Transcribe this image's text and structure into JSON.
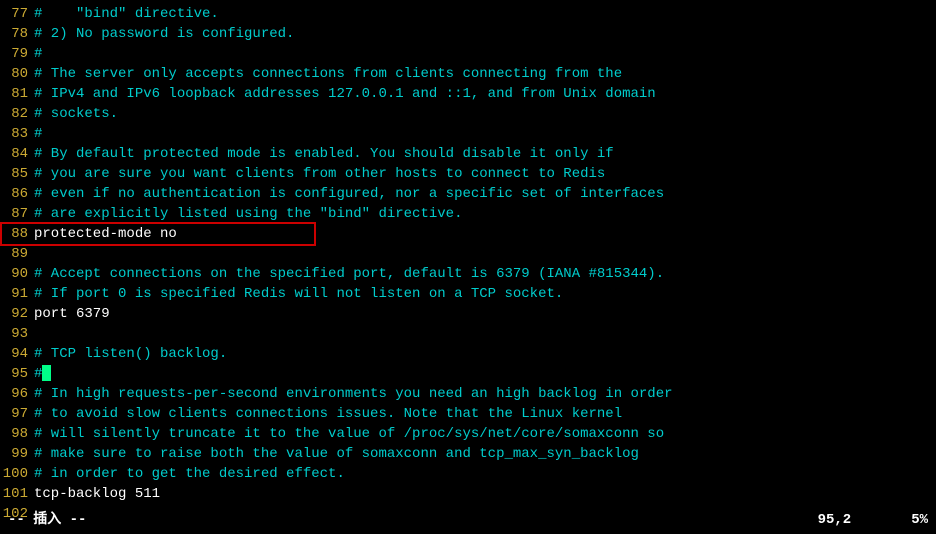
{
  "lines": [
    {
      "no": "77",
      "text": "#    \"bind\" directive.",
      "style": "comment"
    },
    {
      "no": "78",
      "text": "# 2) No password is configured.",
      "style": "comment"
    },
    {
      "no": "79",
      "text": "#",
      "style": "comment"
    },
    {
      "no": "80",
      "text": "# The server only accepts connections from clients connecting from the",
      "style": "comment"
    },
    {
      "no": "81",
      "text": "# IPv4 and IPv6 loopback addresses 127.0.0.1 and ::1, and from Unix domain",
      "style": "comment"
    },
    {
      "no": "82",
      "text": "# sockets.",
      "style": "comment"
    },
    {
      "no": "83",
      "text": "#",
      "style": "comment"
    },
    {
      "no": "84",
      "text": "# By default protected mode is enabled. You should disable it only if",
      "style": "comment"
    },
    {
      "no": "85",
      "text": "# you are sure you want clients from other hosts to connect to Redis",
      "style": "comment"
    },
    {
      "no": "86",
      "text": "# even if no authentication is configured, nor a specific set of interfaces",
      "style": "comment"
    },
    {
      "no": "87",
      "text": "# are explicitly listed using the \"bind\" directive.",
      "style": "comment"
    },
    {
      "no": "88",
      "text": "protected-mode no",
      "style": "plain",
      "highlight": true
    },
    {
      "no": "89",
      "text": "",
      "style": "comment"
    },
    {
      "no": "90",
      "text": "# Accept connections on the specified port, default is 6379 (IANA #815344).",
      "style": "comment"
    },
    {
      "no": "91",
      "text": "# If port 0 is specified Redis will not listen on a TCP socket.",
      "style": "comment"
    },
    {
      "no": "92",
      "text": "port 6379",
      "style": "plain"
    },
    {
      "no": "93",
      "text": "",
      "style": "comment"
    },
    {
      "no": "94",
      "text": "# TCP listen() backlog.",
      "style": "comment"
    },
    {
      "no": "95",
      "text": "#",
      "style": "comment",
      "cursor": true
    },
    {
      "no": "96",
      "text": "# In high requests-per-second environments you need an high backlog in order",
      "style": "comment"
    },
    {
      "no": "97",
      "text": "# to avoid slow clients connections issues. Note that the Linux kernel",
      "style": "comment"
    },
    {
      "no": "98",
      "text": "# will silently truncate it to the value of /proc/sys/net/core/somaxconn so",
      "style": "comment"
    },
    {
      "no": "99",
      "text": "# make sure to raise both the value of somaxconn and tcp_max_syn_backlog",
      "style": "comment"
    },
    {
      "no": "100",
      "text": "# in order to get the desired effect.",
      "style": "comment"
    },
    {
      "no": "101",
      "text": "tcp-backlog 511",
      "style": "plain"
    },
    {
      "no": "102",
      "text": "",
      "style": "comment"
    }
  ],
  "status": {
    "mode": "-- 插入 --",
    "position": "95,2",
    "percent": "5%"
  }
}
